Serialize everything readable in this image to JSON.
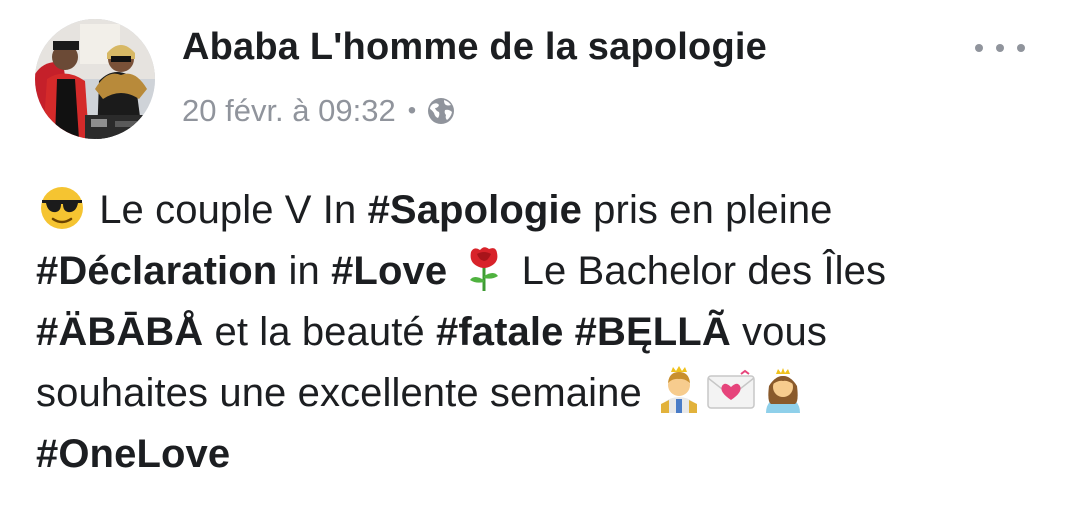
{
  "post": {
    "author": "Ababa L'homme de la sapologie",
    "timestamp": "20 févr. à 09:32",
    "separator": "•",
    "privacy_icon": "globe-icon",
    "more_icon": "more-options-icon",
    "avatar_icon": "profile-photo"
  },
  "body": {
    "line1": {
      "emoji": "smiling-face-with-sunglasses",
      "text1": " Le couple V In ",
      "tag1": "#Sapologie",
      "text2": " pris en pleine"
    },
    "line2": {
      "tag1": "#Déclaration",
      "text1": " in ",
      "tag2": "#Love",
      "emoji": "rose",
      "text2": " Le Bachelor des Îles"
    },
    "line3": {
      "tag1": "#ÄBĀBÅ",
      "text1": " et la beauté ",
      "tag2": "#fatale",
      "text2": " ",
      "tag3": "#BĘLLÃ",
      "text3": " vous"
    },
    "line4": {
      "text1": "souhaites une excellente semaine ",
      "emojis": [
        "prince",
        "love-letter",
        "princess"
      ]
    },
    "line5": {
      "tag1": "#OneLove"
    }
  },
  "colors": {
    "text": "#1c1e21",
    "meta": "#90949c",
    "background": "#ffffff"
  }
}
